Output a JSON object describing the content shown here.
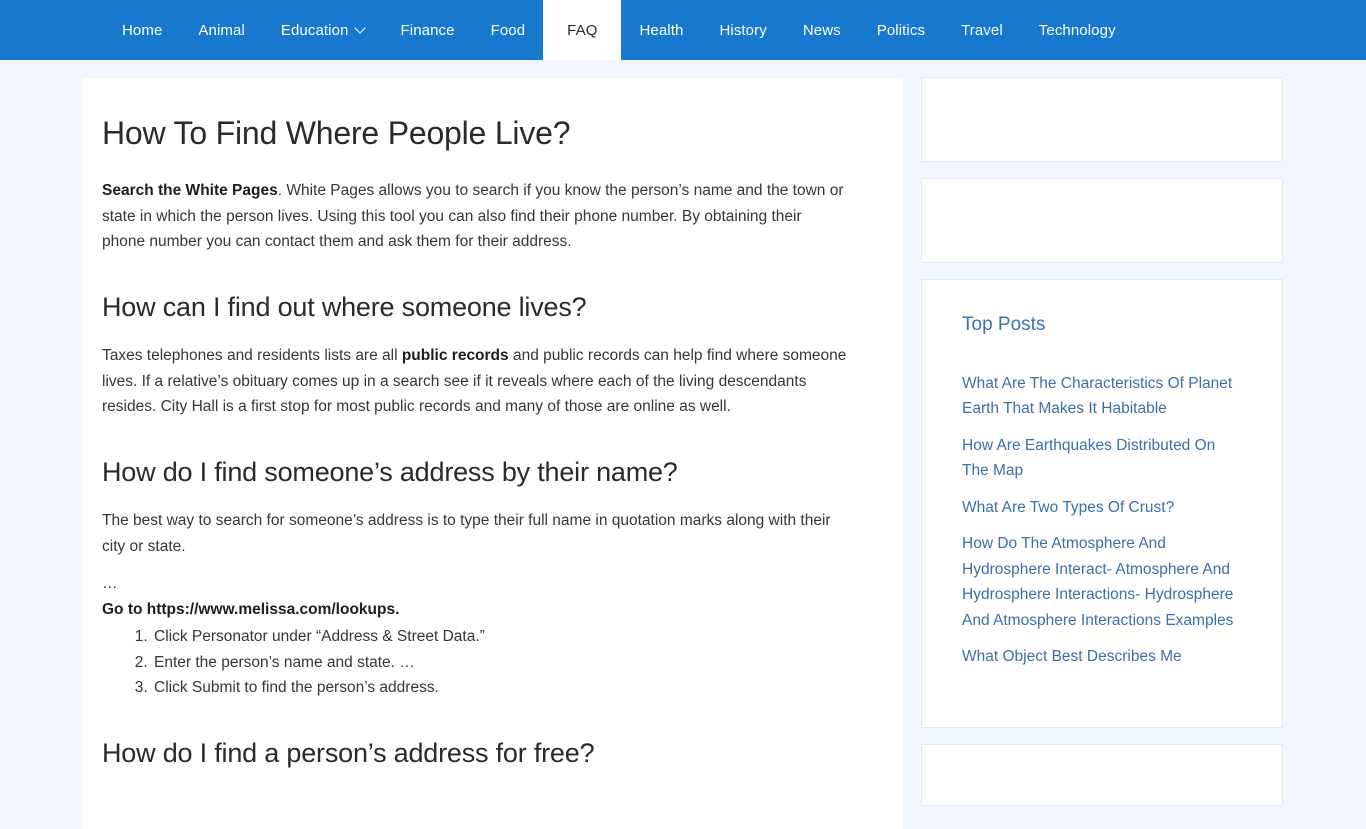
{
  "nav": {
    "items": [
      {
        "label": "Home",
        "active": false,
        "has_dropdown": false
      },
      {
        "label": "Animal",
        "active": false,
        "has_dropdown": false
      },
      {
        "label": "Education",
        "active": false,
        "has_dropdown": true,
        "dropdown_icon": "chevron-down-icon"
      },
      {
        "label": "Finance",
        "active": false,
        "has_dropdown": false
      },
      {
        "label": "Food",
        "active": false,
        "has_dropdown": false
      },
      {
        "label": "FAQ",
        "active": true,
        "has_dropdown": false
      },
      {
        "label": "Health",
        "active": false,
        "has_dropdown": false
      },
      {
        "label": "History",
        "active": false,
        "has_dropdown": false
      },
      {
        "label": "News",
        "active": false,
        "has_dropdown": false
      },
      {
        "label": "Politics",
        "active": false,
        "has_dropdown": false
      },
      {
        "label": "Travel",
        "active": false,
        "has_dropdown": false
      },
      {
        "label": "Technology",
        "active": false,
        "has_dropdown": false
      }
    ],
    "background_color": "#1778ce",
    "active_background_color": "#ffffff",
    "text_color": "#ffffff"
  },
  "article": {
    "title": "How To Find Where People Live?",
    "intro": {
      "lead_bold": "Search the White Pages",
      "rest": ". White Pages allows you to search if you know the person’s name and the town or state in which the person lives. Using this tool you can also find their phone number. By obtaining their phone number you can contact them and ask them for their address."
    },
    "sections": [
      {
        "heading": "How can I find out where someone lives?",
        "paragraph_pre": "Taxes telephones and residents lists are all ",
        "paragraph_bold": "public records",
        "paragraph_post": " and public records can help find where someone lives. If a relative’s obituary comes up in a search see if it reveals where each of the living descendants resides. City Hall is a first stop for most public records and many of those are online as well."
      },
      {
        "heading": "How do I find someone’s address by their name?",
        "paragraph": "The best way to search for someone’s address is to type their full name in quotation marks along with their city or state.",
        "ellipsis": "…",
        "go_to": "Go to https://www.melissa.com/lookups.",
        "steps": [
          "Click Personator under “Address & Street Data.”",
          "Enter the person’s name and state. …",
          "Click Submit to find the person’s address."
        ]
      },
      {
        "heading": "How do I find a person’s address for free?"
      }
    ]
  },
  "sidebar": {
    "widgets": [
      {
        "type": "blank",
        "name": "ad-slot-top"
      },
      {
        "type": "blank",
        "name": "ad-slot-second"
      },
      {
        "type": "top-posts",
        "title": "Top Posts",
        "links": [
          "What Are The Characteristics Of Planet Earth That Makes It Habitable",
          "How Are Earthquakes Distributed On The Map",
          "What Are Two Types Of Crust?",
          "How Do The Atmosphere And Hydrosphere Interact- Atmosphere And Hydrosphere Interactions- Hydrosphere And Atmosphere Interactions Examples",
          "What Object Best Describes Me"
        ],
        "title_color": "#3a74b0",
        "link_color": "#3b6fa8"
      },
      {
        "type": "blank",
        "name": "ad-slot-bottom"
      }
    ]
  },
  "theme": {
    "page_background": "#f2f6fe",
    "card_background": "#ffffff",
    "brand_blue": "#1778ce",
    "body_text_color": "#32373c",
    "heading_color": "#2a2a2a"
  }
}
